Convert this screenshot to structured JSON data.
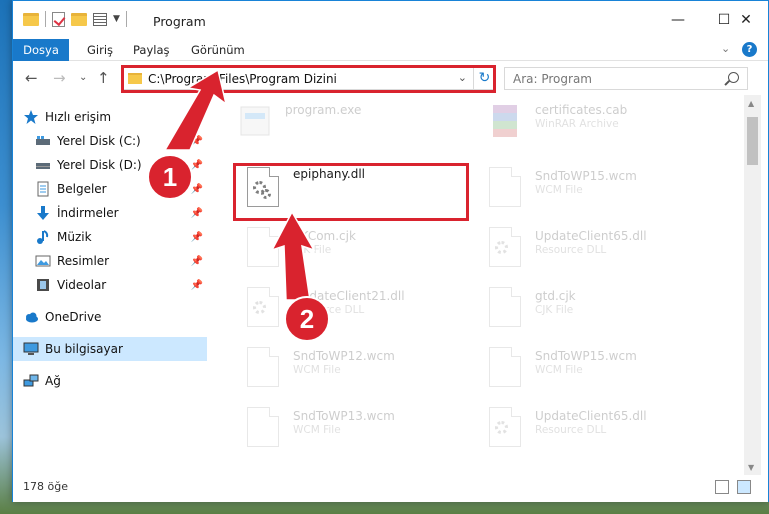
{
  "window": {
    "title": "Program",
    "controls": {
      "minimize": "—",
      "maximize": "☐",
      "close": "✕"
    }
  },
  "ribbon": {
    "tabs": [
      "Dosya",
      "Giriş",
      "Paylaş",
      "Görünüm"
    ],
    "expand": "⌄",
    "help": "?"
  },
  "nav": {
    "back": "←",
    "forward": "→",
    "recent": "⌄",
    "up": "↑",
    "address": "C:\\Program Files\\Program Dizini",
    "address_drop": "⌄",
    "refresh": "↻",
    "search_placeholder": "Ara: Program"
  },
  "sidebar": {
    "items": [
      {
        "label": "Hızlı erişim",
        "icon": "star-icon",
        "pinned": false
      },
      {
        "label": "Yerel Disk (C:)",
        "icon": "drive-icon",
        "pinned": true
      },
      {
        "label": "Yerel Disk (D:)",
        "icon": "drive-icon",
        "pinned": true
      },
      {
        "label": "Belgeler",
        "icon": "documents-icon",
        "pinned": true
      },
      {
        "label": "İndirmeler",
        "icon": "download-icon",
        "pinned": true
      },
      {
        "label": "Müzik",
        "icon": "music-icon",
        "pinned": true
      },
      {
        "label": "Resimler",
        "icon": "pictures-icon",
        "pinned": true
      },
      {
        "label": "Videolar",
        "icon": "video-icon",
        "pinned": true
      },
      {
        "label": "OneDrive",
        "icon": "cloud-icon",
        "pinned": false
      },
      {
        "label": "Bu bilgisayar",
        "icon": "computer-icon",
        "pinned": false,
        "selected": true
      },
      {
        "label": "Ağ",
        "icon": "network-icon",
        "pinned": false
      }
    ]
  },
  "files": [
    {
      "name": "program.exe",
      "type": "",
      "icon": "exe-icon",
      "faded": true
    },
    {
      "name": "certificates.cab",
      "type": "WinRAR Archive",
      "icon": "winrar-icon",
      "faded": true
    },
    {
      "name": "epiphany.dll",
      "type": "",
      "icon": "dll-gear-icon",
      "faded": false,
      "highlighted": true
    },
    {
      "name": "SndToWP15.wcm",
      "type": "WCM File",
      "icon": "file-icon",
      "faded": true
    },
    {
      "name": "SKCom.cjk",
      "type": "CJK File",
      "icon": "file-icon",
      "faded": true
    },
    {
      "name": "UpdateClient65.dll",
      "type": "Resource DLL",
      "icon": "dll-gear-icon",
      "faded": true
    },
    {
      "name": "UpdateClient21.dll",
      "type": "Resource DLL",
      "icon": "dll-gear-icon",
      "faded": true
    },
    {
      "name": "gtd.cjk",
      "type": "CJK File",
      "icon": "file-icon",
      "faded": true
    },
    {
      "name": "SndToWP12.wcm",
      "type": "WCM File",
      "icon": "file-icon",
      "faded": true
    },
    {
      "name": "SndToWP15.wcm",
      "type": "WCM File",
      "icon": "file-icon",
      "faded": true
    },
    {
      "name": "SndToWP13.wcm",
      "type": "WCM File",
      "icon": "file-icon",
      "faded": true
    },
    {
      "name": "UpdateClient65.dll",
      "type": "Resource DLL",
      "icon": "dll-gear-icon",
      "faded": true
    }
  ],
  "annotations": {
    "step1": "1",
    "step2": "2",
    "color": "#d9232e"
  },
  "status": {
    "item_count": "178 öğe"
  },
  "colors": {
    "accent": "#1979ca",
    "selection": "#cce8ff",
    "highlight": "#d9232e"
  }
}
